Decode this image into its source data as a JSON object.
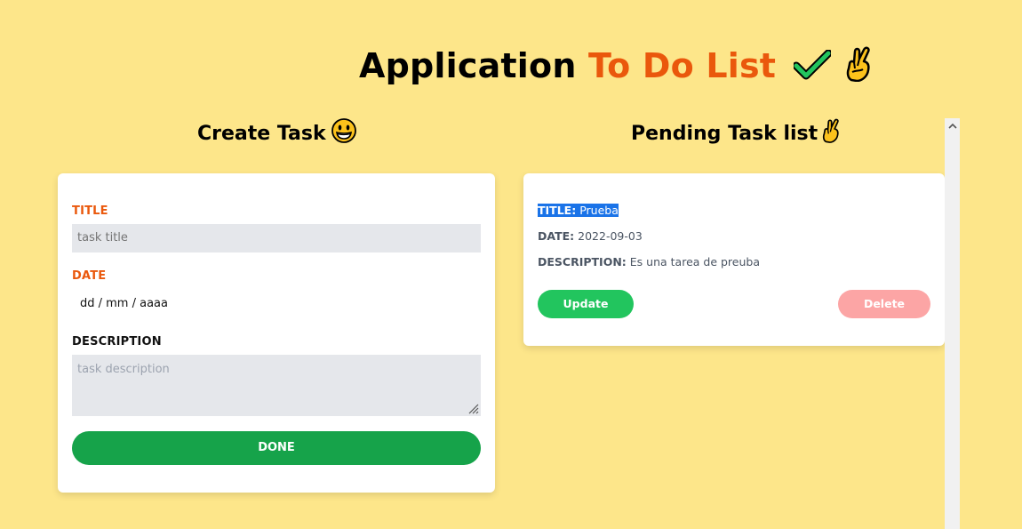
{
  "header": {
    "title_part1": "Application",
    "title_part2": "To Do List",
    "icons": [
      "check-mark-icon",
      "crossed-fingers-icon"
    ]
  },
  "create_section": {
    "heading": "Create Task",
    "heading_icon": "grinning-face-icon",
    "form": {
      "title_label": "TITLE",
      "title_placeholder": "task title",
      "title_value": "",
      "date_label": "DATE",
      "date_placeholder": "dd / mm / aaaa",
      "description_label": "DESCRIPTION",
      "description_placeholder": "task description",
      "description_value": "",
      "done_label": "DONE"
    }
  },
  "pending_section": {
    "heading": "Pending Task list",
    "heading_icon": "crossed-fingers-icon",
    "tasks": [
      {
        "title_label": "TITLE:",
        "title": "Prueba",
        "date_label": "DATE:",
        "date": "2022-09-03",
        "description_label": "DESCRIPTION:",
        "description": "Es una tarea de preuba",
        "update_label": "Update",
        "delete_label": "Delete"
      }
    ]
  },
  "colors": {
    "background": "#fde68a",
    "accent": "#ea580c",
    "done_button": "#16a34a",
    "update_button": "#22c55e",
    "delete_button": "#fca5a5",
    "selection": "#1a73e8"
  }
}
